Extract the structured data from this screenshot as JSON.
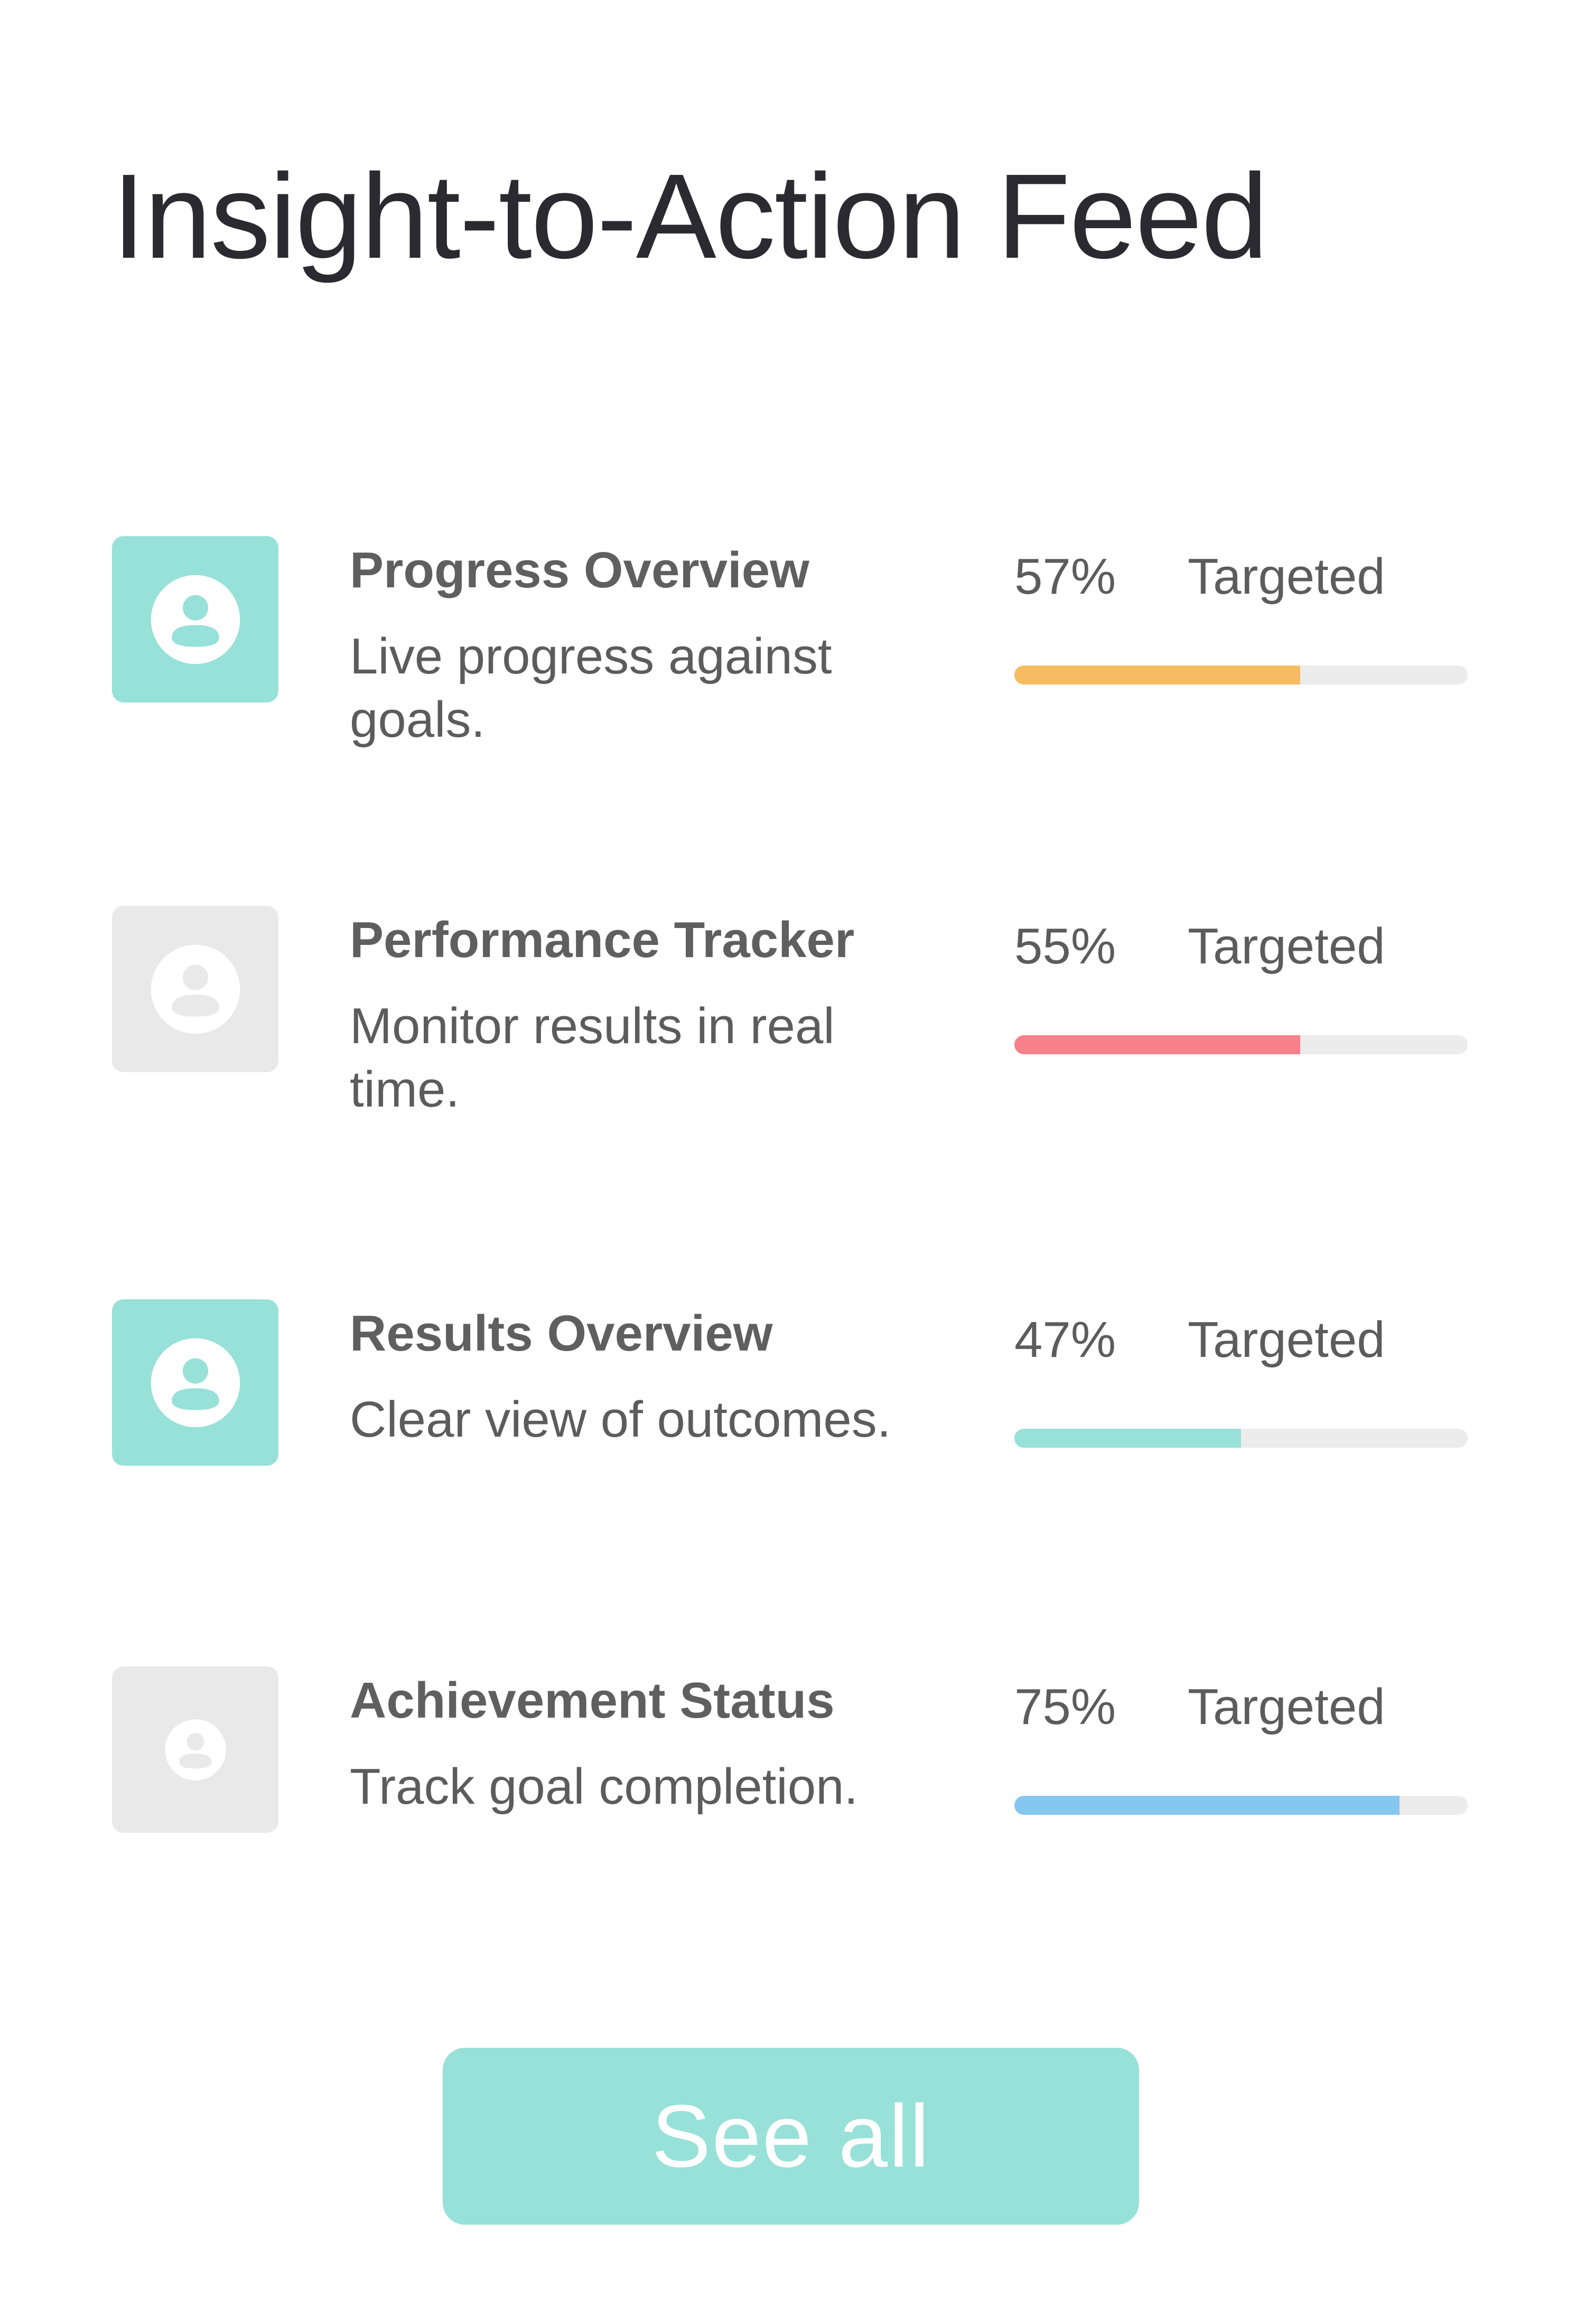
{
  "header": {
    "title": "Insight-to-Action Feed"
  },
  "items": [
    {
      "title": "Progress Overview",
      "description": "Live progress against goals.",
      "percent_label": "57%",
      "status": "Targeted",
      "bar_fill_fraction": 0.63,
      "bar_color": "#f7bb62",
      "avatar_style": "active",
      "icon": "user-icon"
    },
    {
      "title": "Performance Tracker",
      "description": "Monitor results in real time.",
      "percent_label": "55%",
      "status": "Targeted",
      "bar_fill_fraction": 0.63,
      "bar_color": "#f7808a",
      "avatar_style": "inactive",
      "icon": "user-icon"
    },
    {
      "title": "Results Overview",
      "description": "Clear view of outcomes.",
      "percent_label": "47%",
      "status": "Targeted",
      "bar_fill_fraction": 0.5,
      "bar_color": "#97e1d8",
      "avatar_style": "active",
      "icon": "user-icon"
    },
    {
      "title": "Achievement Status",
      "description": "Track goal completion.",
      "percent_label": "75%",
      "status": "Targeted",
      "bar_fill_fraction": 0.85,
      "bar_color": "#86c7ef",
      "avatar_style": "inactive",
      "icon": "user-icon"
    }
  ],
  "footer": {
    "see_all_label": "See all",
    "button_color": "#97e1d8"
  }
}
